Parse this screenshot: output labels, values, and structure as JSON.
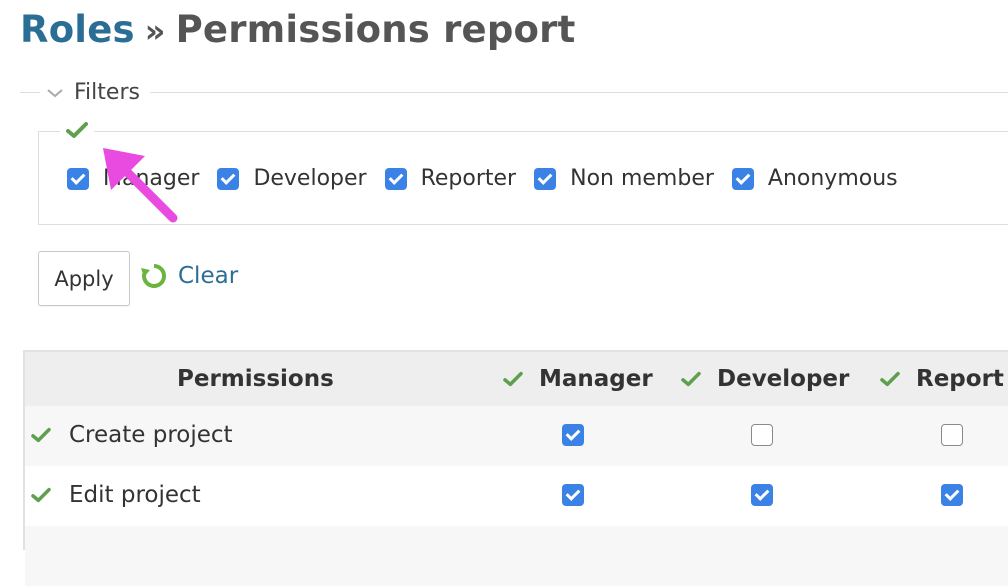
{
  "breadcrumb": {
    "parent": "Roles",
    "separator": "»",
    "current": "Permissions report"
  },
  "filters": {
    "legend": "Filters",
    "roles": [
      {
        "label": "Manager",
        "checked": true
      },
      {
        "label": "Developer",
        "checked": true
      },
      {
        "label": "Reporter",
        "checked": true
      },
      {
        "label": "Non member",
        "checked": true
      },
      {
        "label": "Anonymous",
        "checked": true
      }
    ]
  },
  "actions": {
    "apply_label": "Apply",
    "clear_label": "Clear"
  },
  "table": {
    "permissions_header": "Permissions",
    "columns": [
      "Manager",
      "Developer",
      "Report"
    ],
    "rows": [
      {
        "label": "Create project",
        "values": [
          true,
          false,
          false
        ]
      },
      {
        "label": "Edit project",
        "values": [
          true,
          true,
          true
        ]
      }
    ]
  },
  "colors": {
    "link": "#2b6e95",
    "checkbox": "#3b82e6",
    "check_icon": "#5fa04e",
    "arrow": "#e94ae0"
  },
  "icons": {
    "toggle_all": "green-check-icon",
    "clear": "refresh-icon",
    "legend": "chevron-down-icon"
  }
}
